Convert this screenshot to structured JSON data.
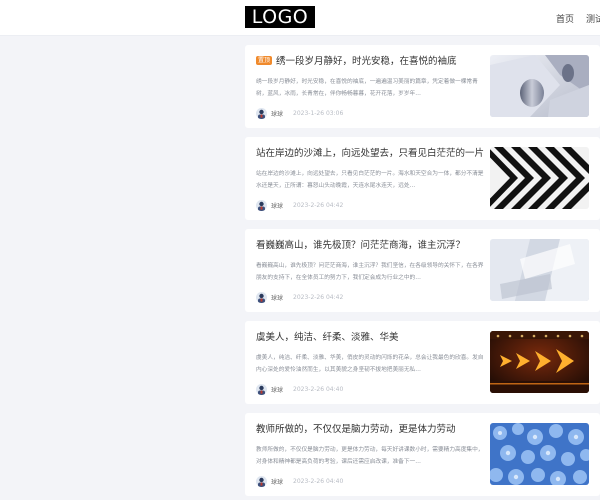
{
  "header": {
    "logo_text": "LOGO",
    "nav": [
      "首页",
      "测试"
    ]
  },
  "posts": [
    {
      "tag": "置顶",
      "title": "绣一段岁月静好，时光安稳，在喜悦的袖底",
      "excerpt": "绣一段岁月静好，时光安稳，在喜悦的袖底，一遍遍温习美丽的篇章，凭定着做一棵常青树，蓝风，冰雨，长青常在，伴你畅畅暮暮，花开花落，岁岁年…",
      "author": "球球",
      "date": "2023-1-26 03:06",
      "thumb": "silver-abstract"
    },
    {
      "tag": "",
      "title": "站在岸边的沙滩上，向远处望去，只看见白茫茫的一片",
      "excerpt": "站在岸边的沙滩上，向远处望去，只看见白茫茫的一片。海水和天空合为一体，都分不清是水还是天，正所谓：暮怒山头动晚霞，天连水尾水连天，远处…",
      "author": "球球",
      "date": "2023-2-26 04:42",
      "thumb": "black-white-chevrons"
    },
    {
      "tag": "",
      "title": "看巍巍高山，谁先极顶？问茫茫商海，谁主沉浮？",
      "excerpt": "看巍巍高山，谁先极顶？问茫茫商海，谁主沉浮？我们坚信，在各级领导的关怀下，在各界朋友的支持下，在全体员工的努力下，我们定会成为行业之中的…",
      "author": "球球",
      "date": "2023-2-26 04:42",
      "thumb": "white-geometric"
    },
    {
      "tag": "",
      "title": "虞美人，纯洁、纤柔、淡雅、华美",
      "excerpt": "虞美人，纯洁、纤柔、淡雅、华美，俏皮的灵动的闪烁的花朵，总会让我最色的欣喜。发自内心深处的爱怜油然而生，以其美貌之身坚韧不拔地把美丽无私…",
      "author": "球球",
      "date": "2023-2-26 04:40",
      "thumb": "neon-arrows"
    },
    {
      "tag": "",
      "title": "教师所做的，不仅仅是脑力劳动，更是体力劳动",
      "excerpt": "教师所做的，不仅仅是脑力劳动，更是体力劳动，每天好讲课数小时，需要精力高度集中，对身体和精神都是高负荷的考验，课后还需应启改课，准备下一…",
      "author": "球球",
      "date": "2023-2-26 04:40",
      "thumb": "blue-flowers"
    }
  ],
  "colors": {
    "tag_bg": "#f08a2c",
    "page_bg": "#f3f4f8",
    "muted_text": "#8a8f98",
    "date_text": "#b8bcc4"
  }
}
